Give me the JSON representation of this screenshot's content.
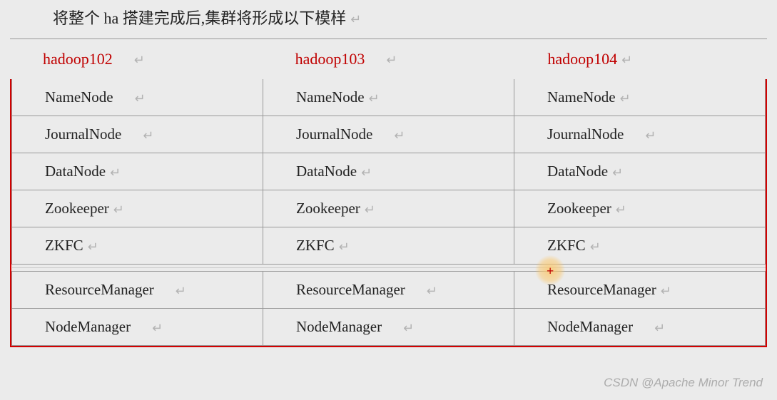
{
  "title": "将整个 ha 搭建完成后,集群将形成以下模样",
  "headers": [
    "hadoop102",
    "hadoop103",
    "hadoop104"
  ],
  "rows": [
    [
      "NameNode",
      "NameNode",
      "NameNode"
    ],
    [
      "JournalNode",
      "JournalNode",
      "JournalNode"
    ],
    [
      "DataNode",
      "DataNode",
      "DataNode"
    ],
    [
      "Zookeeper",
      "Zookeeper",
      "Zookeeper"
    ],
    [
      "ZKFC",
      "ZKFC",
      "ZKFC"
    ]
  ],
  "rows2": [
    [
      "ResourceManager",
      "ResourceManager",
      "ResourceManager"
    ],
    [
      "NodeManager",
      "NodeManager",
      "NodeManager"
    ]
  ],
  "watermark": "CSDN @Apache Minor Trend",
  "glyphs": {
    "crlf": "↵"
  }
}
